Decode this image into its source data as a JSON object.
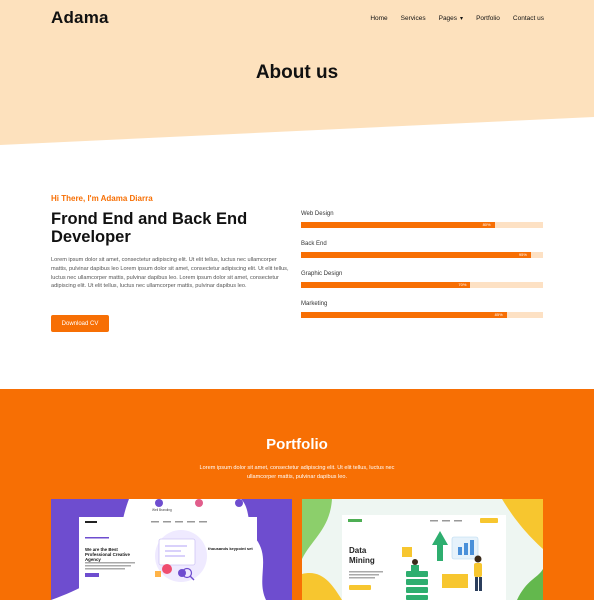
{
  "header": {
    "brand": "Adama",
    "nav": [
      {
        "label": "Home"
      },
      {
        "label": "Services"
      },
      {
        "label": "Pages",
        "has_dropdown": true
      },
      {
        "label": "Portfolio"
      },
      {
        "label": "Contact us"
      }
    ],
    "page_title": "About us"
  },
  "about": {
    "greeting": "Hi There, I'm Adama Diarra",
    "headline": "Frond End and Back End Developer",
    "paragraph": "Lorem ipsum dolor sit amet, consectetur adipiscing elit. Ut elit tellus, luctus nec ullamcorper mattis, pulvinar dapibus leo Lorem ipsum dolor sit amet, consectetur adipiscing elit. Ut elit tellus, luctus nec ullamcorper mattis, pulvinar dapibus leo. Lorem ipsum dolor sit amet, consectetur adipiscing elit. Ut elit tellus, luctus nec ullamcorper mattis, pulvinar dapibus leo.",
    "button_label": "Download CV",
    "skills": [
      {
        "label": "Web Design",
        "value": 80,
        "value_label": "80%"
      },
      {
        "label": "Back End",
        "value": 95,
        "value_label": "95%"
      },
      {
        "label": "Graphic Design",
        "value": 70,
        "value_label": "70%"
      },
      {
        "label": "Marketing",
        "value": 85,
        "value_label": "85%"
      }
    ]
  },
  "portfolio": {
    "title": "Portfolio",
    "description": "Lorem ipsum dolor sit amet, consectetur adipiscing elit. Ut elit tellus, luctus nec ullamcorper mattis, pulvinar dapibus leo.",
    "items": [
      {
        "heading": "We are the Best Professional Creative Agency",
        "subheading": "thousands keypoint set"
      },
      {
        "heading": "Data Mining"
      }
    ]
  },
  "colors": {
    "accent": "#f76f04",
    "hero_bg": "#fde1bd",
    "track": "#fde1c4",
    "purple": "#6e4dcf"
  }
}
